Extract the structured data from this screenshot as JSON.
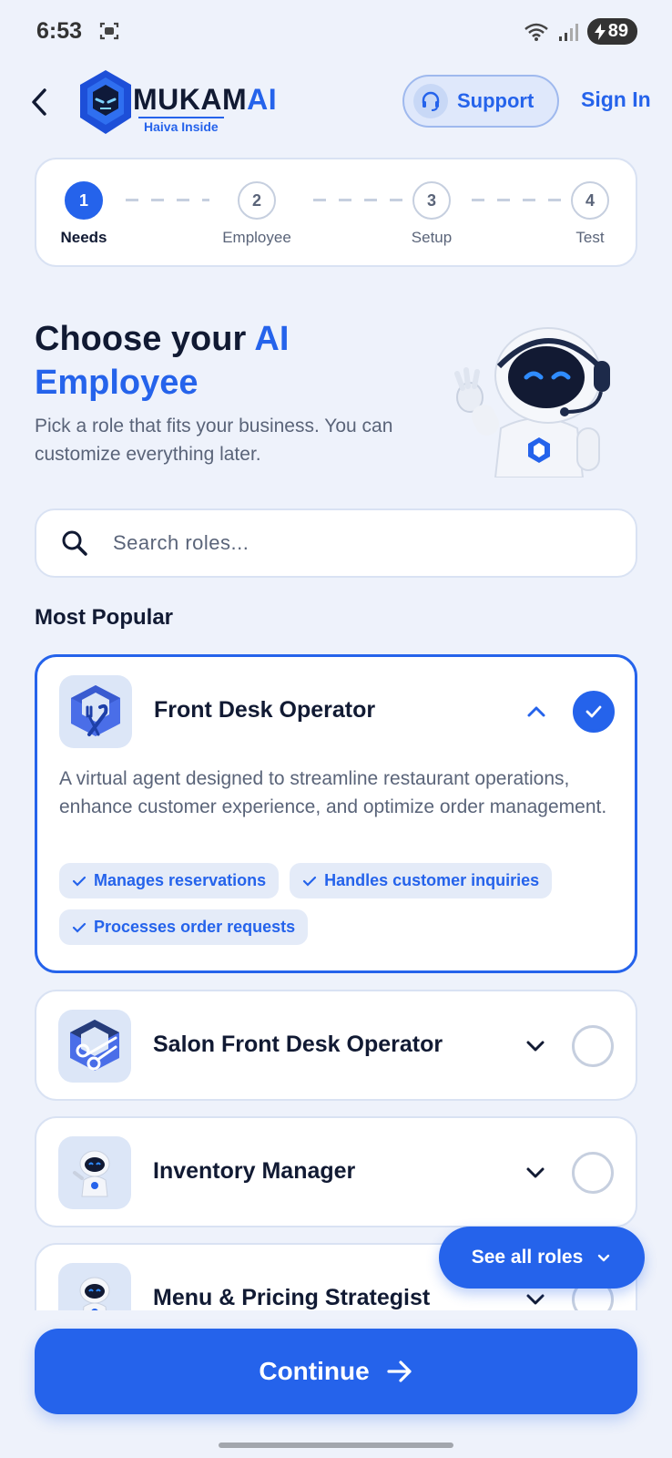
{
  "status_bar": {
    "time": "6:53",
    "battery": "89",
    "icons": [
      "screen-record-icon",
      "wifi-icon",
      "signal-icon",
      "battery-charging-icon"
    ]
  },
  "header": {
    "back_icon": "chevron-left-icon",
    "logo": {
      "brand_main": "MUKAM",
      "brand_accent": "AI",
      "tagline": "Haiva Inside"
    },
    "support_label": "Support",
    "signin_label": "Sign In"
  },
  "stepper": {
    "steps": [
      {
        "number": "1",
        "label": "Needs",
        "active": true
      },
      {
        "number": "2",
        "label": "Employee",
        "active": false
      },
      {
        "number": "3",
        "label": "Setup",
        "active": false
      },
      {
        "number": "4",
        "label": "Test",
        "active": false
      }
    ]
  },
  "hero": {
    "title_part1": "Choose your ",
    "title_accent": "AI",
    "title_part2": "Employee",
    "subtitle": "Pick a role that fits your business. You can customize everything later."
  },
  "search": {
    "placeholder": "Search roles..."
  },
  "section_title": "Most Popular",
  "roles": [
    {
      "title": "Front Desk Operator",
      "selected": true,
      "expanded": true,
      "icon": "restaurant-cube-icon",
      "description": "A virtual agent designed to streamline restaurant operations, enhance customer experience, and optimize order management.",
      "tags": [
        "Manages reservations",
        "Handles customer inquiries",
        "Processes order requests"
      ]
    },
    {
      "title": "Salon Front Desk Operator",
      "selected": false,
      "expanded": false,
      "icon": "salon-cube-icon"
    },
    {
      "title": "Inventory Manager",
      "selected": false,
      "expanded": false,
      "icon": "robot-icon"
    },
    {
      "title": "Menu & Pricing Strategist",
      "selected": false,
      "expanded": false,
      "icon": "robot-icon"
    }
  ],
  "see_all_label": "See all roles",
  "continue_label": "Continue",
  "colors": {
    "accent": "#2563eb",
    "background": "#eef2fb",
    "text": "#111a33",
    "muted": "#5a6479"
  }
}
